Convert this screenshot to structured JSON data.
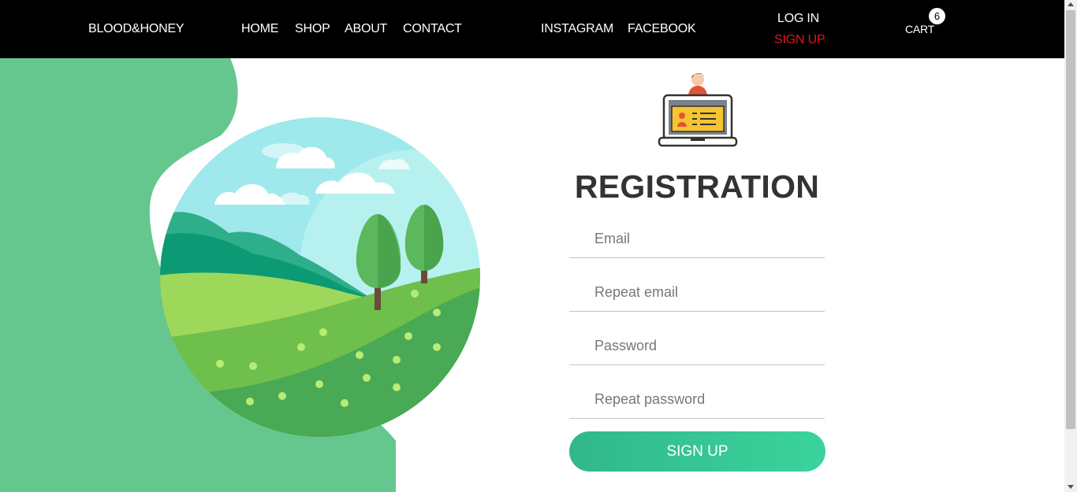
{
  "nav": {
    "brand": "BLOOD&HONEY",
    "links": [
      "HOME",
      "SHOP",
      "ABOUT",
      "CONTACT"
    ],
    "social": [
      "INSTAGRAM",
      "FACEBOOK"
    ],
    "login": "LOG IN",
    "signup": "SIGN UP",
    "cart_label": "CART",
    "cart_count": "6"
  },
  "form": {
    "title": "REGISTRATION",
    "email_placeholder": "Email",
    "repeat_email_placeholder": "Repeat email",
    "password_placeholder": "Password",
    "repeat_password_placeholder": "Repeat password",
    "submit_label": "SIGN UP"
  },
  "icons": {
    "registration": "laptop-user-profile-icon",
    "illustration": "landscape-illustration"
  },
  "colors": {
    "navbar_bg": "#000000",
    "signup_link": "#e3141b",
    "accent_green": "#3bd39d",
    "blob_green": "#66c78e",
    "title_text": "#333333"
  }
}
